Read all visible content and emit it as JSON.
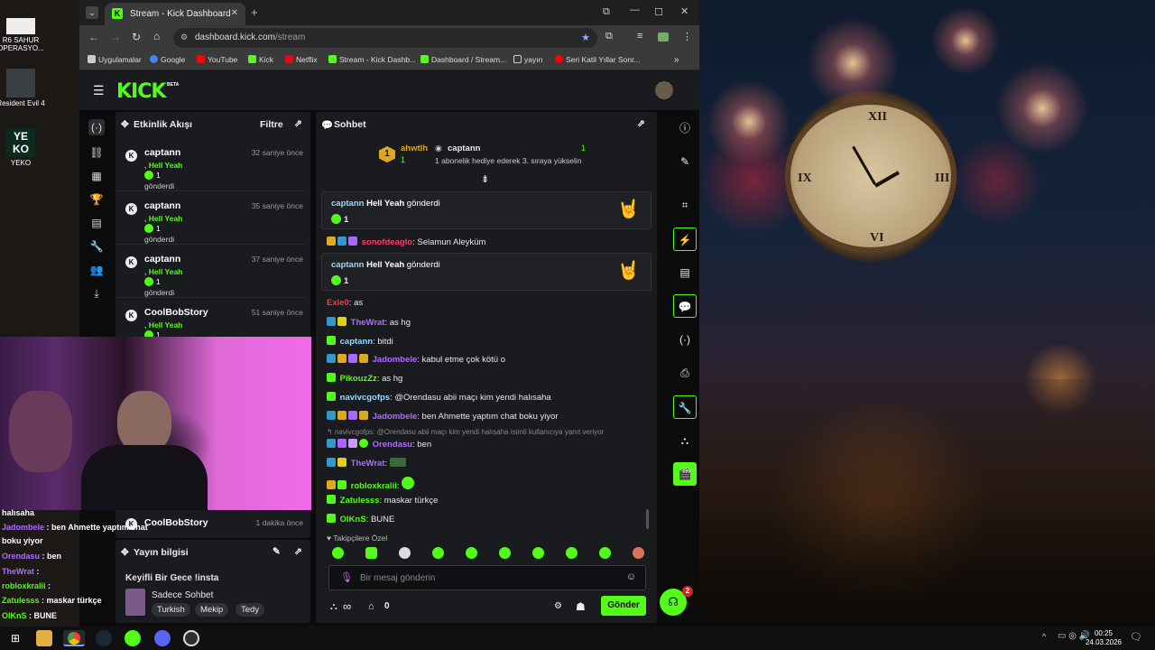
{
  "desktop": {
    "icons": [
      {
        "label": "R6 SAHUR OPERASYO..."
      },
      {
        "label": "Resident Evil 4"
      },
      {
        "label": "YEKO"
      }
    ]
  },
  "browser": {
    "tab_title": "Stream - Kick Dashboard",
    "url_host": "dashboard.kick.com",
    "url_path": "/stream",
    "bookmarks": [
      "Uygulamalar",
      "Google",
      "YouTube",
      "Kick",
      "Netflix",
      "Stream - Kick Dashb...",
      "Dashboard / Stream...",
      "yayın",
      "Seri Katil Yıllar Sonr..."
    ]
  },
  "kick": {
    "logo": "KICK",
    "logo_tag": "BETA",
    "activity": {
      "title": "Etkinlik Akışı",
      "filter": "Filtre",
      "events": [
        {
          "user": "captann",
          "time": "32 saniye önce",
          "gift": ", Hell Yeah",
          "count": "1",
          "sent": "gönderdi"
        },
        {
          "user": "captann",
          "time": "35 saniye önce",
          "gift": ", Hell Yeah",
          "count": "1",
          "sent": "gönderdi"
        },
        {
          "user": "captann",
          "time": "37 saniye önce",
          "gift": ", Hell Yeah",
          "count": "1",
          "sent": "gönderdi"
        },
        {
          "user": "CoolBobStory",
          "time": "51 saniye önce",
          "gift": ", Hell Yeah",
          "count": "1",
          "sent": ""
        }
      ],
      "last_user": "CoolBobStory",
      "last_time": "1 dakika önce"
    },
    "stream_info": {
      "title": "Yayın bilgisi",
      "stream_title": "Keyifli Bir Gece !insta",
      "category": "Sadece Sohbet",
      "tags": [
        "Turkish",
        "Mekip",
        "Tedy"
      ]
    },
    "chat": {
      "title": "Sohbet",
      "leader": {
        "rank": "1",
        "user1": "ahwtlh",
        "count1": "1",
        "user2": "captann",
        "count2": "1",
        "note": "1 abonelik hediye ederek 3. sıraya yükselin"
      },
      "gift1": {
        "user": "captann",
        "item": "Hell Yeah",
        "verb": "gönderdi",
        "count": "1"
      },
      "gift2": {
        "user": "captann",
        "item": "Hell Yeah",
        "verb": "gönderdi",
        "count": "1"
      },
      "messages": [
        {
          "user": "sonofdeaglo",
          "text": ": Selamun Aleyküm",
          "color": "#ff3b6b"
        },
        {
          "user": "Exle0",
          "text": ": as",
          "color": "#ff3b3b"
        },
        {
          "user": "TheWrat",
          "text": ": as hg",
          "color": "#b06cff"
        },
        {
          "user": "captann",
          "text": ": bitdi",
          "color": "#9fd8ff"
        },
        {
          "user": "Jadombele",
          "text": ": kabul etme çok kötü o",
          "color": "#b06cff"
        },
        {
          "user": "PikouzZz",
          "text": ": as hg",
          "color": "#53fc18"
        },
        {
          "user": "navivcgofps",
          "text": ": @Orendasu abii maçı kim yendi halısaha",
          "color": "#9fd8ff"
        },
        {
          "user": "Jadombele",
          "text": ": ben Ahmette yaptım chat boku yiyor",
          "color": "#b06cff"
        },
        {
          "user": "Orendasu",
          "text": ": ben",
          "color": "#b06cff"
        },
        {
          "user": "TheWrat",
          "text": ":",
          "color": "#b06cff"
        },
        {
          "user": "robloxkralii",
          "text": ":",
          "color": "#53fc18"
        },
        {
          "user": "Zatulesss",
          "text": ": maskar türkçe",
          "color": "#53fc18"
        },
        {
          "user": "OlKnS",
          "text": ": BUNE",
          "color": "#53fc18"
        }
      ],
      "reply_note": "navivcgofps: @Orendasu abii maçı kim yendi halısaha isimli kullanıcıya yanıt veriyor",
      "followers_only": "Takipçilere Özel",
      "placeholder": "Bir mesaj gönderin",
      "infinity": "∞",
      "zero": "0",
      "send": "Gönder",
      "notif_count": "2"
    }
  },
  "overlay": {
    "lines": [
      {
        "user": "",
        "text": "halısaha"
      },
      {
        "user": "Jadombele",
        "text": " : ben Ahmette yaptım chat"
      },
      {
        "user": "",
        "text": "boku yiyor"
      },
      {
        "user": "Orendasu",
        "text": " : ben"
      },
      {
        "user": "TheWrat",
        "text": " :"
      },
      {
        "user": "robloxkralii",
        "text": " :"
      },
      {
        "user": "Zatulesss",
        "text": " : maskar türkçe"
      },
      {
        "user": "OlKnS",
        "text": " : BUNE"
      }
    ]
  },
  "taskbar": {
    "time": "00:25",
    "date": "24.03.2026"
  },
  "colors": {
    "kick_green": "#53fc18",
    "panel": "#191b1f"
  }
}
